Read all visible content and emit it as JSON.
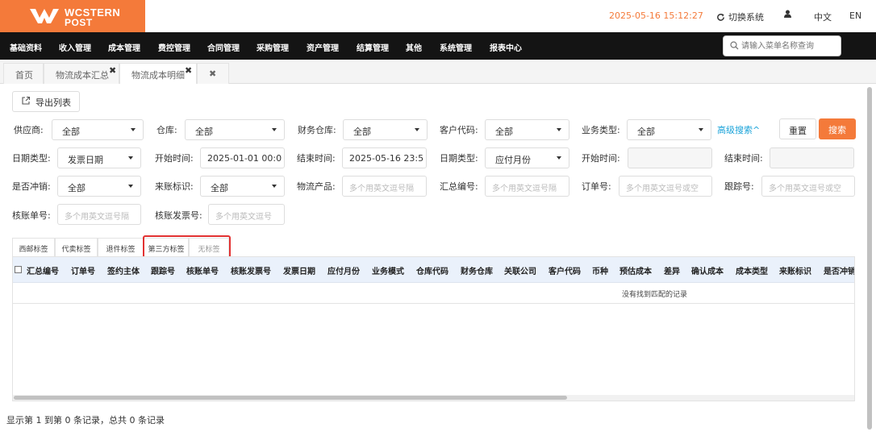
{
  "brand": {
    "line1": "WCSTERN",
    "line2": "POST",
    "color": "#f47a3a"
  },
  "topbar": {
    "datetime": "2025-05-16 15:12:27",
    "switch_label": "切换系统",
    "lang_zh": "中文",
    "lang_en": "EN"
  },
  "nav": {
    "items": [
      "基础资料",
      "收入管理",
      "成本管理",
      "费控管理",
      "合同管理",
      "采购管理",
      "资产管理",
      "结算管理",
      "其他",
      "系统管理",
      "报表中心"
    ],
    "search_placeholder": "请输入菜单名称查询"
  },
  "tabs": [
    {
      "label": "首页"
    },
    {
      "label": "物流成本汇总"
    },
    {
      "label": "物流成本明细"
    }
  ],
  "toolbar": {
    "export_label": "导出列表"
  },
  "filters": {
    "supplier": {
      "label": "供应商:",
      "value": "全部"
    },
    "warehouse": {
      "label": "仓库:",
      "value": "全部"
    },
    "finance_warehouse": {
      "label": "财务仓库:",
      "value": "全部"
    },
    "customer_code": {
      "label": "客户代码:",
      "value": "全部"
    },
    "business_type": {
      "label": "业务类型:",
      "value": "全部"
    },
    "advanced_search": "高级搜索^",
    "reset": "重置",
    "search": "搜索",
    "date_type1": {
      "label": "日期类型:",
      "value": "发票日期"
    },
    "start_time1": {
      "label": "开始时间:",
      "value": "2025-01-01 00:0"
    },
    "end_time1": {
      "label": "结束时间:",
      "value": "2025-05-16 23:5"
    },
    "date_type2": {
      "label": "日期类型:",
      "value": "应付月份"
    },
    "start_time2": {
      "label": "开始时间:",
      "value": ""
    },
    "end_time2": {
      "label": "结束时间:",
      "value": ""
    },
    "is_offset": {
      "label": "是否冲销:",
      "value": "全部"
    },
    "bill_tag": {
      "label": "来账标识:",
      "value": "全部"
    },
    "logistics_product": {
      "label": "物流产品:",
      "placeholder": "多个用英文逗号隔"
    },
    "summary_no": {
      "label": "汇总编号:",
      "placeholder": "多个用英文逗号隔"
    },
    "order_no": {
      "label": "订单号:",
      "placeholder": "多个用英文逗号或空"
    },
    "tracking_no": {
      "label": "跟踪号:",
      "placeholder": "多个用英文逗号或空"
    },
    "verify_no": {
      "label": "核账单号:",
      "placeholder": "多个用英文逗号隔"
    },
    "verify_invoice_no": {
      "label": "核账发票号:",
      "placeholder": "多个用英文逗号"
    }
  },
  "label_tabs": [
    "西邮标签",
    "代卖标签",
    "退件标签",
    "第三方标签",
    "无标签"
  ],
  "table": {
    "columns": [
      "汇总编号",
      "订单号",
      "签约主体",
      "跟踪号",
      "核账单号",
      "核账发票号",
      "发票日期",
      "应付月份",
      "业务模式",
      "仓库代码",
      "财务仓库",
      "关联公司",
      "客户代码",
      "币种",
      "预估成本",
      "差异",
      "确认成本",
      "成本类型",
      "来账标识",
      "是否冲销"
    ],
    "empty_text": "没有找到匹配的记录"
  },
  "footer": {
    "info": "显示第 1 到第 0 条记录，总共 0 条记录"
  }
}
